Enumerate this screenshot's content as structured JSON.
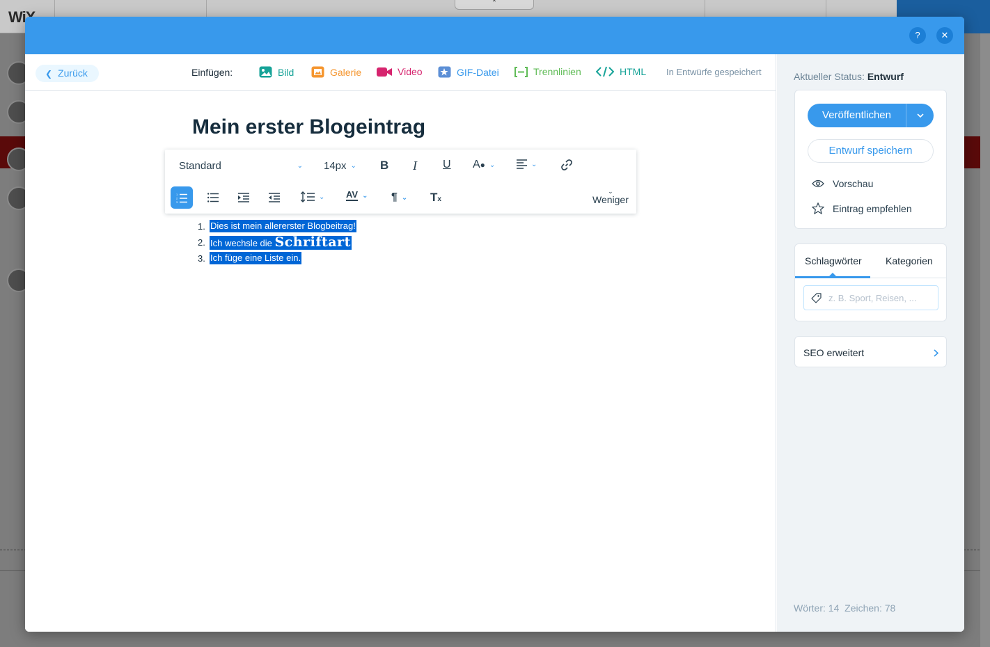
{
  "background": {
    "logo": "WiX"
  },
  "modal": {
    "header": {
      "help_label": "?",
      "close_label": "✕"
    },
    "topbar": {
      "back_label": "Zurück",
      "insert_label": "Einfügen:",
      "insert_items": [
        {
          "label": "Bild",
          "color": "#17a398",
          "icon": "image-icon"
        },
        {
          "label": "Galerie",
          "color": "#f5962f",
          "icon": "gallery-icon"
        },
        {
          "label": "Video",
          "color": "#d6246e",
          "icon": "video-icon"
        },
        {
          "label": "GIF-Datei",
          "color": "#3899ec",
          "icon": "gif-icon"
        },
        {
          "label": "Trennlinien",
          "color": "#60bc57",
          "icon": "divider-icon"
        },
        {
          "label": "HTML",
          "color": "#17a398",
          "icon": "html-icon"
        }
      ],
      "saved_status": "In Entwürfe gespeichert"
    },
    "title": "Mein erster Blogeintrag",
    "toolbar": {
      "style_value": "Standard",
      "size_value": "14px",
      "less_label": "Weniger"
    },
    "list": [
      {
        "number": "1.",
        "text": "Dies ist mein allererster Blogbeitrag!"
      },
      {
        "number": "2.",
        "text_prefix": "Ich wechsle die ",
        "text_fancy": "Schriftart"
      },
      {
        "number": "3.",
        "text": "Ich füge eine Liste ein."
      }
    ],
    "sidebar": {
      "status_label": "Aktueller Status:",
      "status_value": "Entwurf",
      "publish_label": "Veröffentlichen",
      "save_draft_label": "Entwurf speichern",
      "preview_label": "Vorschau",
      "recommend_label": "Eintrag empfehlen",
      "tabs": [
        {
          "label": "Schlagwörter",
          "active": true
        },
        {
          "label": "Kategorien",
          "active": false
        }
      ],
      "tag_placeholder": "z. B. Sport, Reisen, ...",
      "seo_label": "SEO erweitert",
      "word_count": "Wörter: 14",
      "char_count": "Zeichen: 78"
    },
    "colors": {
      "accent": "#3899ec",
      "selection": "#0066d6"
    }
  }
}
